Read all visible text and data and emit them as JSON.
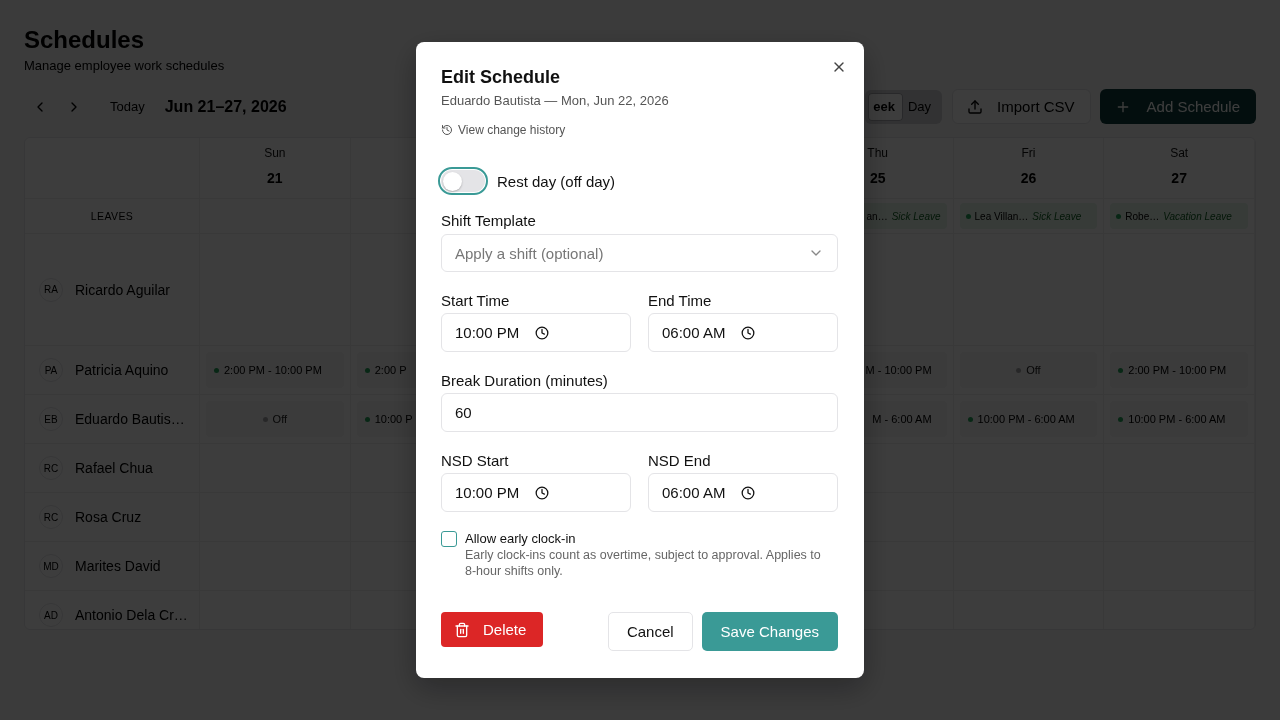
{
  "page": {
    "title": "Schedules",
    "subtitle": "Manage employee work schedules"
  },
  "toolbar": {
    "today": "Today",
    "range": "Jun 21–27, 2026",
    "views": [
      {
        "label": "eek",
        "selected": true
      },
      {
        "label": "Day",
        "selected": false
      }
    ],
    "import_button": "Import CSV",
    "add_button": "Add Schedule"
  },
  "calendar": {
    "days": {
      "sun": {
        "name": "Sun",
        "date": "21"
      },
      "thu": {
        "name": "Thu",
        "date": "25"
      },
      "fri": {
        "name": "Fri",
        "date": "26"
      },
      "sat": {
        "name": "Sat",
        "date": "27"
      }
    },
    "leaves_label": "LEAVES",
    "leaves": {
      "thu": {
        "name": "an…",
        "type": "Sick Leave"
      },
      "fri": {
        "name": "Lea Villan…",
        "type": "Sick Leave"
      },
      "sat": {
        "name": "Robe…",
        "type": "Vacation Leave"
      }
    },
    "employees": [
      {
        "initials": "RA",
        "name": "Ricardo Aguilar"
      },
      {
        "initials": "PA",
        "name": "Patricia Aquino",
        "cells": {
          "sun": {
            "kind": "shift",
            "text": "2:00 PM - 10:00 PM"
          },
          "mon": {
            "kind": "shift",
            "text": "2:00 P"
          },
          "thu": {
            "kind": "shift",
            "text": "M - 10:00 PM"
          },
          "fri": {
            "kind": "off",
            "text": "Off"
          },
          "sat": {
            "kind": "shift",
            "text": "2:00 PM - 10:00 PM"
          }
        }
      },
      {
        "initials": "EB",
        "name": "Eduardo Bautis…",
        "cells": {
          "sun": {
            "kind": "off",
            "text": "Off"
          },
          "mon": {
            "kind": "shift",
            "text": "10:00 P"
          },
          "thu": {
            "kind": "shift",
            "text": "M - 6:00 AM"
          },
          "fri": {
            "kind": "shift",
            "text": "10:00 PM - 6:00 AM"
          },
          "sat": {
            "kind": "shift",
            "text": "10:00 PM - 6:00 AM"
          }
        }
      },
      {
        "initials": "RC",
        "name": "Rafael Chua"
      },
      {
        "initials": "RC",
        "name": "Rosa Cruz"
      },
      {
        "initials": "MD",
        "name": "Marites David"
      },
      {
        "initials": "AD",
        "name": "Antonio Dela Cr…"
      }
    ]
  },
  "dialog": {
    "title": "Edit Schedule",
    "subtitle": "Eduardo Bautista — Mon, Jun 22, 2026",
    "history_link": "View change history",
    "rest_day": {
      "label": "Rest day (off day)",
      "on": false
    },
    "shift_template": {
      "label": "Shift Template",
      "placeholder": "Apply a shift (optional)"
    },
    "start_time": {
      "label": "Start Time",
      "value": "10:00 PM"
    },
    "end_time": {
      "label": "End Time",
      "value": "06:00 AM"
    },
    "break_duration": {
      "label": "Break Duration (minutes)",
      "value": "60"
    },
    "nsd_start": {
      "label": "NSD Start",
      "value": "10:00 PM"
    },
    "nsd_end": {
      "label": "NSD End",
      "value": "06:00 AM"
    },
    "early_clock_in": {
      "label": "Allow early clock-in",
      "checked": false,
      "help": "Early clock-ins count as overtime, subject to approval. Applies to 8-hour shifts only."
    },
    "buttons": {
      "delete": "Delete",
      "cancel": "Cancel",
      "save": "Save Changes"
    }
  }
}
